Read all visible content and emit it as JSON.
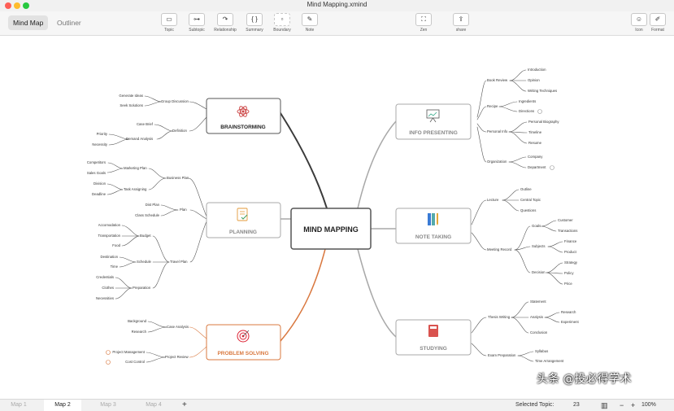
{
  "window": {
    "title": "Mind Mapping.xmind"
  },
  "view_tabs": [
    "Mind Map",
    "Outliner"
  ],
  "toolbar": {
    "topic": "Topic",
    "subtopic": "Subtopic",
    "relationship": "Relationship",
    "summary": "Summary",
    "boundary": "Boundary",
    "note": "Note",
    "zen": "Zen",
    "share": "share",
    "icon": "Icon",
    "format": "Format"
  },
  "map": {
    "central": "MIND MAPPING",
    "branches": {
      "brainstorming": {
        "title": "BRAINSTORMING",
        "children": [
          {
            "label": "Group Discussion",
            "children": [
              "Generate Ideas",
              "Seek Solutions"
            ]
          },
          {
            "label": "Definition",
            "children": [
              {
                "label": "Case Brief"
              },
              {
                "label": "Demand Analysis",
                "children": [
                  "Priority",
                  "Necessity"
                ]
              }
            ]
          }
        ]
      },
      "planning": {
        "title": "PLANNING",
        "children": [
          {
            "label": "Business Plan",
            "children": [
              {
                "label": "Marketing Plan",
                "children": [
                  "Competitors",
                  "Sales Goals"
                ]
              },
              {
                "label": "Task Assigning",
                "children": [
                  "Division",
                  "Deadline"
                ]
              }
            ]
          },
          {
            "label": "Plan",
            "children": [
              "Dist Plan",
              "Class Schedule"
            ]
          },
          {
            "label": "Travel Plan",
            "children": [
              {
                "label": "Budget",
                "children": [
                  "Accomodation",
                  "Transportation",
                  "Food"
                ]
              },
              {
                "label": "Schedule",
                "children": [
                  "Destination",
                  "Time"
                ]
              },
              {
                "label": "Preparation",
                "children": [
                  "Credentials",
                  "Clothes",
                  "Necessities"
                ]
              }
            ]
          }
        ]
      },
      "problem_solving": {
        "title": "PROBLEM SOLVING",
        "children": [
          {
            "label": "Case Analysis",
            "children": [
              "Background",
              "Research"
            ]
          },
          {
            "label": "Project Review",
            "children": [
              "Project Management",
              "Cost Control"
            ]
          }
        ]
      },
      "info_presenting": {
        "title": "INFO PRESENTING",
        "children": [
          {
            "label": "Book Review",
            "children": [
              "Introduction",
              "Opinion",
              "Writing Techniques"
            ]
          },
          {
            "label": "Recipe",
            "children": [
              "Ingredients",
              "Directions"
            ]
          },
          {
            "label": "Personal Info",
            "children": [
              "Personal Biography",
              "Timeline",
              "Resume"
            ]
          },
          {
            "label": "Organization",
            "children": [
              "Company",
              "Department"
            ]
          }
        ]
      },
      "note_taking": {
        "title": "NOTE TAKING",
        "children": [
          {
            "label": "Lecture",
            "children": [
              "Outline",
              "Central Topic",
              "Questions"
            ]
          },
          {
            "label": "Meeting Record",
            "children": [
              {
                "label": "Goals",
                "children": [
                  "Customer",
                  "Transactions"
                ]
              },
              {
                "label": "Subjects",
                "children": [
                  "Finance",
                  "Product"
                ]
              },
              {
                "label": "Decision",
                "children": [
                  "Strategy",
                  "Policy",
                  "Price"
                ]
              }
            ]
          }
        ]
      },
      "studying": {
        "title": "STUDYING",
        "children": [
          {
            "label": "Thesis Writing",
            "children": [
              {
                "label": "Statement"
              },
              {
                "label": "Analysis",
                "children": [
                  "Research",
                  "Experiment"
                ]
              },
              {
                "label": "Conclusion"
              }
            ]
          },
          {
            "label": "Exam Preparation",
            "children": [
              "Syllabus",
              "Time Arrangement"
            ]
          }
        ]
      }
    }
  },
  "map_tabs": [
    "Map 1",
    "Map 2",
    "Map 3",
    "Map 4"
  ],
  "add_tab": "+",
  "status": {
    "selected_topic_label": "Selected Topic:",
    "selected_topic_count": "23",
    "zoom_minus": "−",
    "zoom_plus": "+",
    "zoom": "100%"
  },
  "watermark": "头条 @投必得学术",
  "colors": {
    "accent": "#f06a50",
    "central_border": "#555555",
    "dark_branch": "#3a3a3a",
    "light_branch": "#a8a8a8",
    "orange_branch": "#d9783f"
  }
}
